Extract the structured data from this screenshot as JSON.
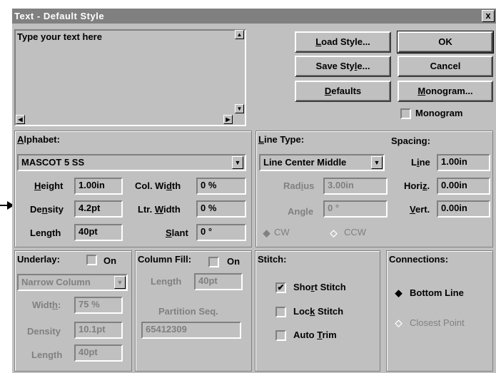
{
  "window": {
    "title": "Text - Default Style",
    "close_glyph": "x"
  },
  "text_area": {
    "value": "Type your text here"
  },
  "buttons": {
    "load_style": "Load Style...",
    "save_style": "Save Style...",
    "defaults": "Defaults",
    "ok": "OK",
    "cancel": "Cancel",
    "monogram": "Monogram..."
  },
  "monogram_checkbox": {
    "label": "Monogram",
    "checked": false
  },
  "alphabet": {
    "label": "Alphabet:",
    "font": "MASCOT 5 SS",
    "height_label": "Height",
    "height": "1.00in",
    "density_label": "Density",
    "density": "4.2pt",
    "length_label": "Length",
    "length": "40pt",
    "col_width_label": "Col. Width",
    "col_width": "0 %",
    "ltr_width_label": "Ltr. Width",
    "ltr_width": "0 %",
    "slant_label": "Slant",
    "slant": "0 °"
  },
  "line_type": {
    "label": "Line Type:",
    "value": "Line Center Middle",
    "radius_label": "Radius",
    "radius": "3.00in",
    "angle_label": "Angle",
    "angle": "0 °",
    "cw_label": "CW",
    "ccw_label": "CCW",
    "selected": "CW"
  },
  "spacing": {
    "label": "Spacing:",
    "line_label": "Line",
    "line": "1.00in",
    "horiz_label": "Horiz.",
    "horiz": "0.00in",
    "vert_label": "Vert.",
    "vert": "0.00in"
  },
  "underlay": {
    "label": "Underlay:",
    "on_label": "On",
    "on": false,
    "type": "Narrow Column",
    "width_label": "Width:",
    "width": "75 %",
    "density_label": "Density",
    "density": "10.1pt",
    "length_label": "Length",
    "length": "40pt"
  },
  "column_fill": {
    "label": "Column Fill:",
    "on_label": "On",
    "on": false,
    "length_label": "Length",
    "length": "40pt",
    "partition_label": "Partition Seq.",
    "partition": "65412309"
  },
  "stitch": {
    "label": "Stitch:",
    "short_stitch": "Short Stitch",
    "short_checked": true,
    "lock_stitch": "Lock Stitch",
    "lock_checked": false,
    "auto_trim": "Auto Trim",
    "auto_checked": false
  },
  "connections": {
    "label": "Connections:",
    "bottom_line": "Bottom Line",
    "closest_point": "Closest Point",
    "selected": "Bottom Line"
  },
  "colors": {
    "face": "#c0c0c0",
    "title_bar": "#808080",
    "disabled_text": "#808080"
  }
}
